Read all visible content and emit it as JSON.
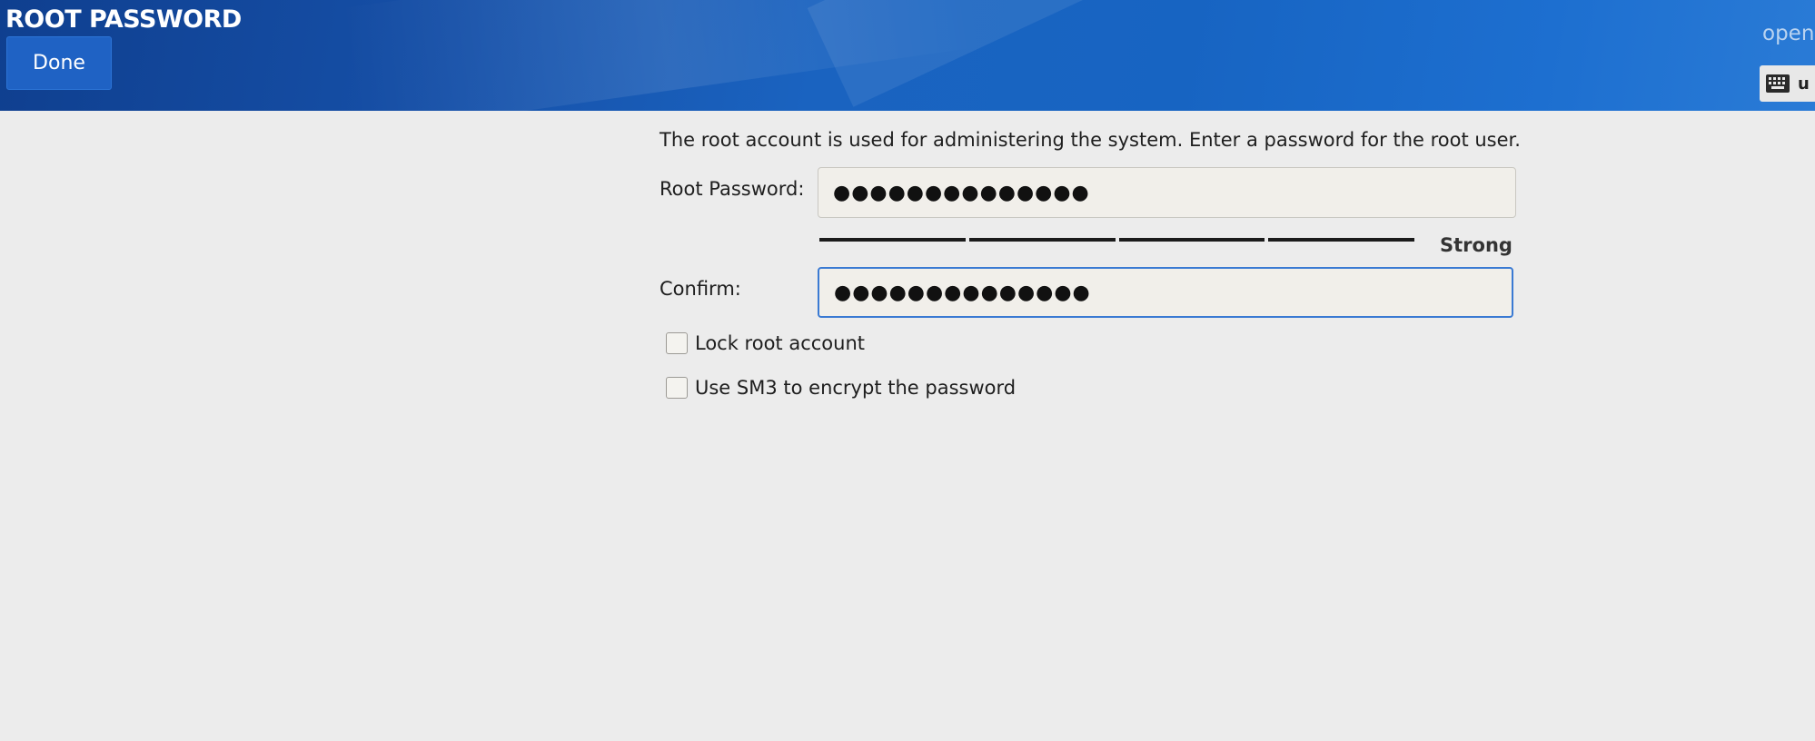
{
  "header": {
    "title": "ROOT PASSWORD",
    "done_label": "Done",
    "product": "open",
    "keyboard_layout": "u",
    "keyboard_icon": "keyboard-icon"
  },
  "form": {
    "intro": "The root account is used for administering the system.  Enter a password for the root user.",
    "root_password_label": "Root Password:",
    "root_password_value": "●●●●●●●●●●●●●●",
    "strength_label": "Strong",
    "strength_segments": 4,
    "confirm_label": "Confirm:",
    "confirm_value": "●●●●●●●●●●●●●●",
    "lock_root_label": "Lock root account",
    "lock_root_checked": false,
    "sm3_label": "Use SM3 to encrypt the password",
    "sm3_checked": false
  }
}
